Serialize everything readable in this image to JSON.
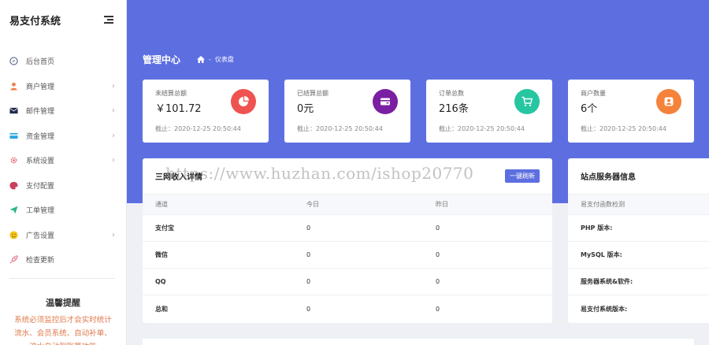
{
  "brand": {
    "title": "易支付系统"
  },
  "sidebar": {
    "items": [
      {
        "label": "后台首页",
        "icon": "compass-icon",
        "color": "#5b6b8c",
        "has_arrow": false
      },
      {
        "label": "商户管理",
        "icon": "user-icon",
        "color": "#f07c4a",
        "has_arrow": true
      },
      {
        "label": "邮件管理",
        "icon": "envelope-icon",
        "color": "#1e2a4a",
        "has_arrow": true
      },
      {
        "label": "资金管理",
        "icon": "card-icon",
        "color": "#2aa7e0",
        "has_arrow": true
      },
      {
        "label": "系统设置",
        "icon": "gear-icon",
        "color": "#e05a6a",
        "has_arrow": true
      },
      {
        "label": "支付配置",
        "icon": "palette-icon",
        "color": "#c8405a",
        "has_arrow": false
      },
      {
        "label": "工单管理",
        "icon": "paper-plane-icon",
        "color": "#2bb58a",
        "has_arrow": false
      },
      {
        "label": "广告设置",
        "icon": "smile-icon",
        "color": "#f2c518",
        "has_arrow": true
      },
      {
        "label": "检查更新",
        "icon": "rocket-icon",
        "color": "#e05a6a",
        "has_arrow": false
      }
    ],
    "tip_title": "温馨提醒",
    "tip_text": "系统必须监控后才会实时统计流水、会员系统、自动补单、流水自动到账等功能"
  },
  "header": {
    "title": "管理中心",
    "breadcrumb": "仪表盘"
  },
  "stats": [
    {
      "label": "未结算总额",
      "value": "￥101.72",
      "note": "截止：2020-12-25 20:50:44",
      "icon": "pie-chart-icon",
      "color": "#ef5350"
    },
    {
      "label": "已结算总额",
      "value": "0元",
      "note": "截止：2020-12-25 20:50:44",
      "icon": "wallet-icon",
      "color": "#7b1fa2"
    },
    {
      "label": "订单总数",
      "value": "216条",
      "note": "截止：2020-12-25 20:50:44",
      "icon": "cart-icon",
      "color": "#26c6a0"
    },
    {
      "label": "商户数量",
      "value": "6个",
      "note": "截止：2020-12-25 20:50:44",
      "icon": "user-circle-icon",
      "color": "#f5823a"
    }
  ],
  "income": {
    "title": "三网收入详情",
    "button": "一键刷新",
    "columns": [
      "通道",
      "今日",
      "昨日"
    ],
    "rows": [
      {
        "channel": "支付宝",
        "today": "0",
        "yesterday": "0"
      },
      {
        "channel": "微信",
        "today": "0",
        "yesterday": "0"
      },
      {
        "channel": "QQ",
        "today": "0",
        "yesterday": "0"
      },
      {
        "channel": "总和",
        "today": "0",
        "yesterday": "0"
      }
    ]
  },
  "server": {
    "title": "站点服务器信息",
    "subheader": "易支付函数检测",
    "rows": [
      "PHP 版本:",
      "MySQL 版本:",
      "服务器系统&软件:",
      "易支付系统版本:"
    ]
  },
  "watermark": "https://www.huzhan.com/ishop20770"
}
